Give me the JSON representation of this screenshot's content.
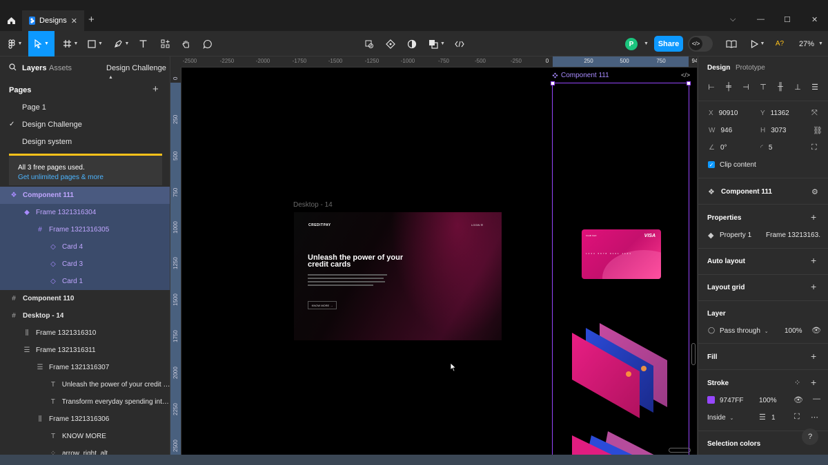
{
  "window": {
    "tab_title": "Designs",
    "tab_close": "✕",
    "new_tab": "+",
    "controls": {
      "dropdown": "⌵",
      "minimize": "—",
      "maximize": "☐",
      "close": "✕"
    }
  },
  "toolbar": {
    "avatar_initial": "P",
    "share_label": "Share",
    "zoom": "27%",
    "accessibility_badge": "A?"
  },
  "left_panel": {
    "tabs": {
      "layers": "Layers",
      "assets": "Assets",
      "page_switcher": "Design Challenge"
    },
    "pages_heading": "Pages",
    "pages": [
      {
        "label": "Page 1",
        "current": false
      },
      {
        "label": "Design Challenge",
        "current": true
      },
      {
        "label": "Design system",
        "current": false
      }
    ],
    "notice": {
      "line1": "All 3 free pages used.",
      "line2": "Get unlimited pages & more"
    },
    "layers": [
      {
        "label": "Component 111",
        "icon": "component-icon",
        "indent": 0,
        "state": "sel-head",
        "bold": true,
        "purple": true
      },
      {
        "label": "Frame 1321316304",
        "icon": "diamond-icon",
        "indent": 1,
        "state": "sel",
        "bold": false,
        "purple": true
      },
      {
        "label": "Frame 1321316305",
        "icon": "frame-icon",
        "indent": 2,
        "state": "sel",
        "bold": false,
        "purple": true
      },
      {
        "label": "Card 4",
        "icon": "instance-icon",
        "indent": 3,
        "state": "sel",
        "bold": false,
        "purple": true
      },
      {
        "label": "Card 3",
        "icon": "instance-icon",
        "indent": 3,
        "state": "sel",
        "bold": false,
        "purple": true
      },
      {
        "label": "Card 1",
        "icon": "instance-icon",
        "indent": 3,
        "state": "sel",
        "bold": false,
        "purple": true
      },
      {
        "label": "Component 110",
        "icon": "frame-icon",
        "indent": 0,
        "state": "",
        "bold": true,
        "purple": false
      },
      {
        "label": "Desktop - 14",
        "icon": "frame-icon",
        "indent": 0,
        "state": "",
        "bold": true,
        "purple": false
      },
      {
        "label": "Frame 1321316310",
        "icon": "hstack-icon",
        "indent": 1,
        "state": "",
        "bold": false,
        "purple": false
      },
      {
        "label": "Frame 1321316311",
        "icon": "vstack-icon",
        "indent": 1,
        "state": "",
        "bold": false,
        "purple": false
      },
      {
        "label": "Frame 1321316307",
        "icon": "vstack-icon",
        "indent": 2,
        "state": "",
        "bold": false,
        "purple": false
      },
      {
        "label": "Unleash the power of your credit c...",
        "icon": "text-icon",
        "indent": 3,
        "state": "",
        "bold": false,
        "purple": false
      },
      {
        "label": "Transform everyday spending into ...",
        "icon": "text-icon",
        "indent": 3,
        "state": "",
        "bold": false,
        "purple": false
      },
      {
        "label": "Frame 1321316306",
        "icon": "hstack-icon",
        "indent": 2,
        "state": "",
        "bold": false,
        "purple": false
      },
      {
        "label": "KNOW MORE",
        "icon": "text-icon",
        "indent": 3,
        "state": "",
        "bold": false,
        "purple": false
      },
      {
        "label": "arrow_right_alt",
        "icon": "grid-icon",
        "indent": 3,
        "state": "",
        "bold": false,
        "purple": false
      }
    ]
  },
  "rulers": {
    "top": [
      "-2500",
      "-2250",
      "-2000",
      "-1750",
      "-1500",
      "-1250",
      "-1000",
      "-750",
      "-500",
      "-250",
      "0",
      "250",
      "500",
      "750",
      "94"
    ],
    "left": [
      "0",
      "250",
      "500",
      "750",
      "1000",
      "1250",
      "1500",
      "1750",
      "2000",
      "2250",
      "2500"
    ]
  },
  "canvas": {
    "desktop_frame_label": "Desktop - 14",
    "component_label": "Component 111",
    "component_code_icon": "</>",
    "hero": {
      "brand": "CREDITPAY",
      "nav": "LOGIN ☰",
      "title": "Unleash the power of your credit cards",
      "button": "KNOW MORE →"
    },
    "card": {
      "title": "Credit Card",
      "brand": "VISA",
      "number": "1234 5678 9101 1121"
    }
  },
  "right_panel": {
    "tabs": {
      "design": "Design",
      "prototype": "Prototype"
    },
    "position": {
      "x_label": "X",
      "x": "90910",
      "y_label": "Y",
      "y": "11362"
    },
    "size": {
      "w_label": "W",
      "w": "946",
      "h_label": "H",
      "h": "3073"
    },
    "rotation": "0°",
    "radius": "5",
    "clip_content": "Clip content",
    "component_name": "Component 111",
    "properties": {
      "title": "Properties",
      "prop_name": "Property 1",
      "prop_value": "Frame 13213163..."
    },
    "auto_layout": "Auto layout",
    "layout_grid": "Layout grid",
    "layer": {
      "title": "Layer",
      "blend": "Pass through",
      "opacity": "100%"
    },
    "fill": "Fill",
    "stroke": {
      "title": "Stroke",
      "color": "9747FF",
      "opacity": "100%",
      "position": "Inside",
      "weight": "1"
    },
    "selection_colors": "Selection colors"
  },
  "colors": {
    "accent": "#0d99ff",
    "component": "#9747ff",
    "warning": "#ffc21a",
    "card_pink": "#e0117a"
  }
}
